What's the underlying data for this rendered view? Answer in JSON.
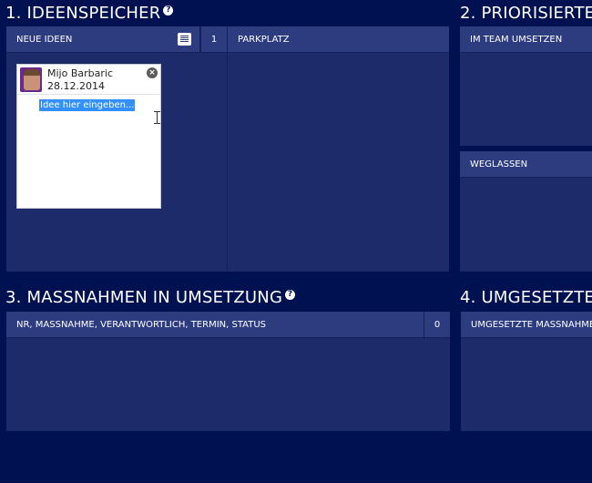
{
  "sections": {
    "ideas": {
      "title": "1. IDEENSPEICHER"
    },
    "prioritized": {
      "title": "2. PRIORISIERTE"
    },
    "measures": {
      "title": "3. MASSNAHMEN IN UMSETZUNG"
    },
    "implemented": {
      "title": "4. UMGESETZTE"
    }
  },
  "columns": {
    "new_ideas": {
      "label": "NEUE IDEEN",
      "count": "1"
    },
    "parking": {
      "label": "PARKPLATZ"
    },
    "team": {
      "label": "IM TEAM UMSETZEN"
    },
    "omit": {
      "label": "WEGLASSEN"
    },
    "measures": {
      "label": "NR, MASSNAHME, VERANTWORTLICH, TERMIN, STATUS",
      "count": "0"
    },
    "implemented": {
      "label": "UMGESETZTE MASSNAHMEN"
    }
  },
  "card": {
    "author": "Mijo Barbaric",
    "date": "28.12.2014",
    "placeholder": "Idee hier eingeben..."
  },
  "icons": {
    "help": "?",
    "close": "×"
  },
  "colors": {
    "background": "#001152",
    "panel": "#1d2b6b",
    "header": "#2c3c7f",
    "selection": "#3390ff"
  }
}
